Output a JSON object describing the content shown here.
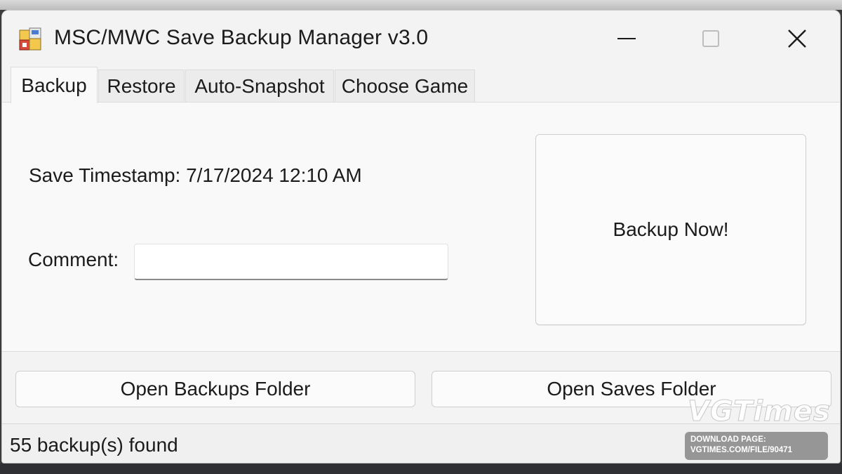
{
  "window": {
    "title": "MSC/MWC Save Backup Manager v3.0",
    "icon": "app-save-icon",
    "controls": [
      "minimize-icon",
      "maximize-icon",
      "close-icon"
    ]
  },
  "tabs": [
    {
      "label": "Backup",
      "active": true
    },
    {
      "label": "Restore",
      "active": false
    },
    {
      "label": "Auto-Snapshot",
      "active": false
    },
    {
      "label": "Choose Game",
      "active": false
    }
  ],
  "backup_panel": {
    "timestamp_label": "Save Timestamp: 7/17/2024 12:10 AM",
    "comment_label": "Comment:",
    "comment_value": "",
    "backup_now_label": "Backup Now!"
  },
  "buttons": {
    "open_backups": "Open Backups Folder",
    "open_saves": "Open Saves Folder"
  },
  "status": {
    "text": "55 backup(s) found"
  },
  "watermark": {
    "logo": "VGTimes",
    "line1": "DOWNLOAD PAGE:",
    "line2": "VGTIMES.COM/FILE/90471"
  },
  "colors": {
    "window_bg": "#f3f3f3",
    "panel_bg": "#f9f9f9",
    "text": "#1b1b1b"
  }
}
